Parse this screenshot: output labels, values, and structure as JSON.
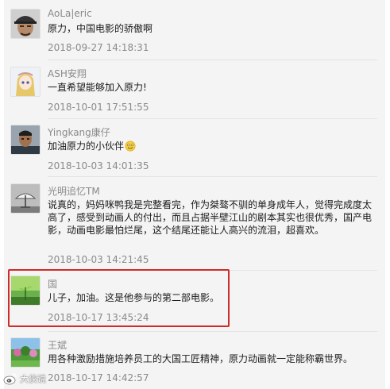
{
  "comments": [
    {
      "user": "AoLa|eric",
      "text": "原力，中国电影的骄傲啊",
      "time": "2018-09-27 14:18:31",
      "avatar_icon": "man-cap-avatar-icon"
    },
    {
      "user": "ASH安翔",
      "text": "一直希望能够加入原力!",
      "time": "2018-10-01 17:51:55",
      "avatar_icon": "anime-girl-avatar-icon"
    },
    {
      "user": "Yingkang康仔",
      "text": "加油原力的小伙伴",
      "emoji": "smiley-emoji-icon",
      "time": "2018-10-03 14:01:35",
      "avatar_icon": "man-portrait-avatar-icon"
    },
    {
      "user": "光明追忆TM",
      "text": "说真的，妈妈咪鸭我是完整看完，作为桀骜不驯的单身成年人，觉得完成度太高了，感受到动画人的付出，而且占据半壁江山的剧本其实也很优秀，国产电影，动画电影最怕烂尾，这个结尾还能让人高兴的流泪，超喜欢。",
      "time": "2018-10-03 14:21:45",
      "avatar_icon": "dish-antenna-avatar-icon"
    },
    {
      "user": "国",
      "text": "儿子，加油。这是他参与的第二部电影。",
      "time": "2018-10-17 13:45:24",
      "avatar_icon": "green-plant-avatar-icon"
    },
    {
      "user": "王斌",
      "text": "用各种激励措施培养员工的大国工匠精神，原力动画就一定能称霸世界。",
      "time": "2018-10-17 14:42:57",
      "avatar_icon": "garden-avatar-icon"
    }
  ],
  "highlight_color": "#cf2b2b",
  "watermark": {
    "text": "大侠说",
    "icon": "weibo-logo-icon"
  }
}
